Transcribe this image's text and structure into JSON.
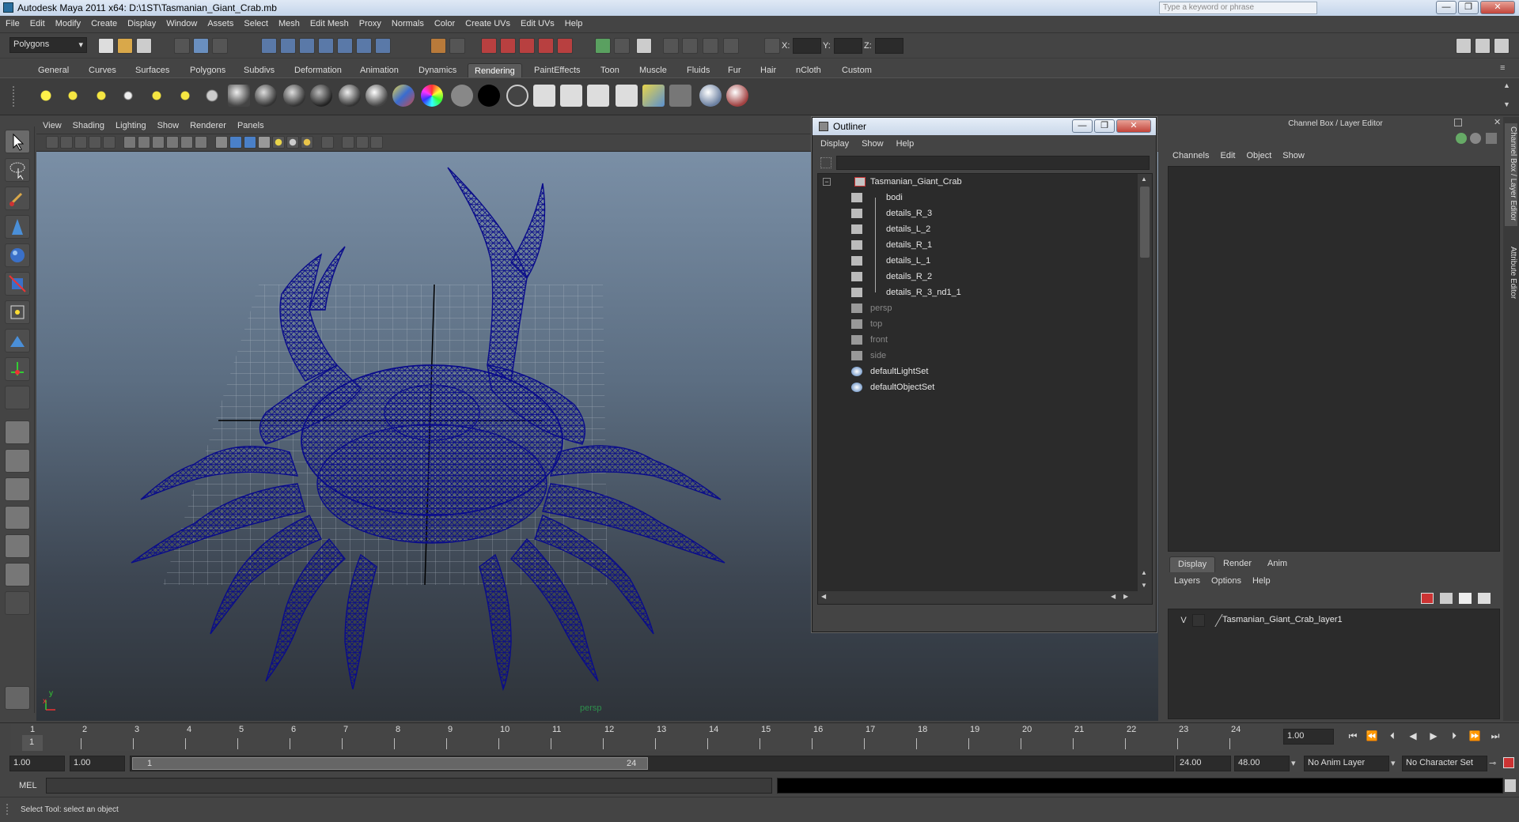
{
  "window": {
    "title": "Autodesk Maya 2011 x64: D:\\1ST\\Tasmanian_Giant_Crab.mb",
    "search_placeholder": "Type a keyword or phrase",
    "controls": [
      "—",
      "❐",
      "✕"
    ]
  },
  "menubar": [
    "File",
    "Edit",
    "Modify",
    "Create",
    "Display",
    "Window",
    "Assets",
    "Select",
    "Mesh",
    "Edit Mesh",
    "Proxy",
    "Normals",
    "Color",
    "Create UVs",
    "Edit UVs",
    "Help"
  ],
  "statusline": {
    "menu_set": "Polygons",
    "x_label": "X:",
    "y_label": "Y:",
    "z_label": "Z:"
  },
  "shelf": {
    "tabs": [
      "General",
      "Curves",
      "Surfaces",
      "Polygons",
      "Subdivs",
      "Deformation",
      "Animation",
      "Dynamics",
      "Rendering",
      "PaintEffects",
      "Toon",
      "Muscle",
      "Fluids",
      "Fur",
      "Hair",
      "nCloth",
      "Custom"
    ],
    "active_tab": "Rendering"
  },
  "viewport": {
    "menu": [
      "View",
      "Shading",
      "Lighting",
      "Show",
      "Renderer",
      "Panels"
    ],
    "camera_label": "persp",
    "axis_x": "x",
    "axis_y": "y"
  },
  "outliner": {
    "title": "Outliner",
    "menu": [
      "Display",
      "Show",
      "Help"
    ],
    "root": "Tasmanian_Giant_Crab",
    "children": [
      "bodi",
      "details_R_3",
      "details_L_2",
      "details_R_1",
      "details_L_1",
      "details_R_2",
      "details_R_3_nd1_1"
    ],
    "cameras": [
      "persp",
      "top",
      "front",
      "side"
    ],
    "sets": [
      "defaultLightSet",
      "defaultObjectSet"
    ]
  },
  "channel_box": {
    "header": "Channel Box / Layer Editor",
    "menu": [
      "Channels",
      "Edit",
      "Object",
      "Show"
    ]
  },
  "layer_editor": {
    "tabs": [
      "Display",
      "Render",
      "Anim"
    ],
    "active_tab": "Display",
    "menu": [
      "Layers",
      "Options",
      "Help"
    ],
    "layer_visibility": "V",
    "layer_name": "Tasmanian_Giant_Crab_layer1"
  },
  "side_tabs": [
    "Channel Box / Layer Editor",
    "Attribute Editor"
  ],
  "time_slider": {
    "frames": [
      "1",
      "2",
      "3",
      "4",
      "5",
      "6",
      "7",
      "8",
      "9",
      "10",
      "11",
      "12",
      "13",
      "14",
      "15",
      "16",
      "17",
      "18",
      "19",
      "20",
      "21",
      "22",
      "23",
      "24"
    ],
    "current_frame_marker": "1",
    "current_time": "1.00"
  },
  "range_slider": {
    "start_time": "1.00",
    "playback_start": "1.00",
    "range_start_label": "1",
    "range_end_label": "24",
    "playback_end": "24.00",
    "end_time": "48.00",
    "anim_layer": "No Anim Layer",
    "character_set": "No Character Set"
  },
  "command_line": {
    "label": "MEL"
  },
  "help_line": {
    "text": "Select Tool: select an object"
  },
  "colors": {
    "wire": "#0a0c8a",
    "panel": "#444444",
    "field": "#2b2b2b",
    "accent": "#5b5b5b"
  }
}
